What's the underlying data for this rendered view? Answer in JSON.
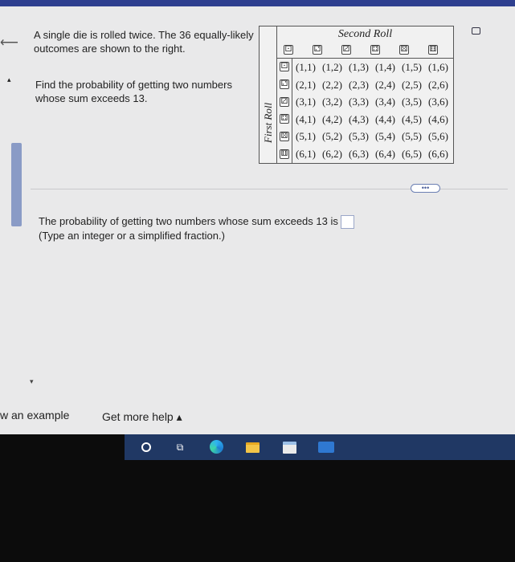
{
  "intro": "A single die is rolled twice. The 36 equally-likely outcomes are shown to the right.",
  "question": "Find the probability of getting two numbers whose sum exceeds 13.",
  "table": {
    "col_header": "Second Roll",
    "row_header": "First Roll",
    "dice_faces": [
      "⚀",
      "⚁",
      "⚂",
      "⚃",
      "⚄",
      "⚅"
    ],
    "rows": [
      [
        "(1,1)",
        "(1,2)",
        "(1,3)",
        "(1,4)",
        "(1,5)",
        "(1,6)"
      ],
      [
        "(2,1)",
        "(2,2)",
        "(2,3)",
        "(2,4)",
        "(2,5)",
        "(2,6)"
      ],
      [
        "(3,1)",
        "(3,2)",
        "(3,3)",
        "(3,4)",
        "(3,5)",
        "(3,6)"
      ],
      [
        "(4,1)",
        "(4,2)",
        "(4,3)",
        "(4,4)",
        "(4,5)",
        "(4,6)"
      ],
      [
        "(5,1)",
        "(5,2)",
        "(5,3)",
        "(5,4)",
        "(5,5)",
        "(5,6)"
      ],
      [
        "(6,1)",
        "(6,2)",
        "(6,3)",
        "(6,4)",
        "(6,5)",
        "(6,6)"
      ]
    ]
  },
  "more_button": "•••",
  "answer": {
    "prompt": "The probability of getting two numbers whose sum exceeds 13 is",
    "value": "",
    "hint": "(Type an integer or a simplified fraction.)"
  },
  "footer": {
    "view_example": "w an example",
    "get_more_help": "Get more help ▴"
  },
  "icons": {
    "back": "⟵",
    "scroll_up": "▴",
    "scroll_down": "▾",
    "task_view": "⧉"
  },
  "colors": {
    "accent": "#2e3f8f",
    "taskbar": "#203864",
    "scrollbar": "#8a9bc6"
  }
}
